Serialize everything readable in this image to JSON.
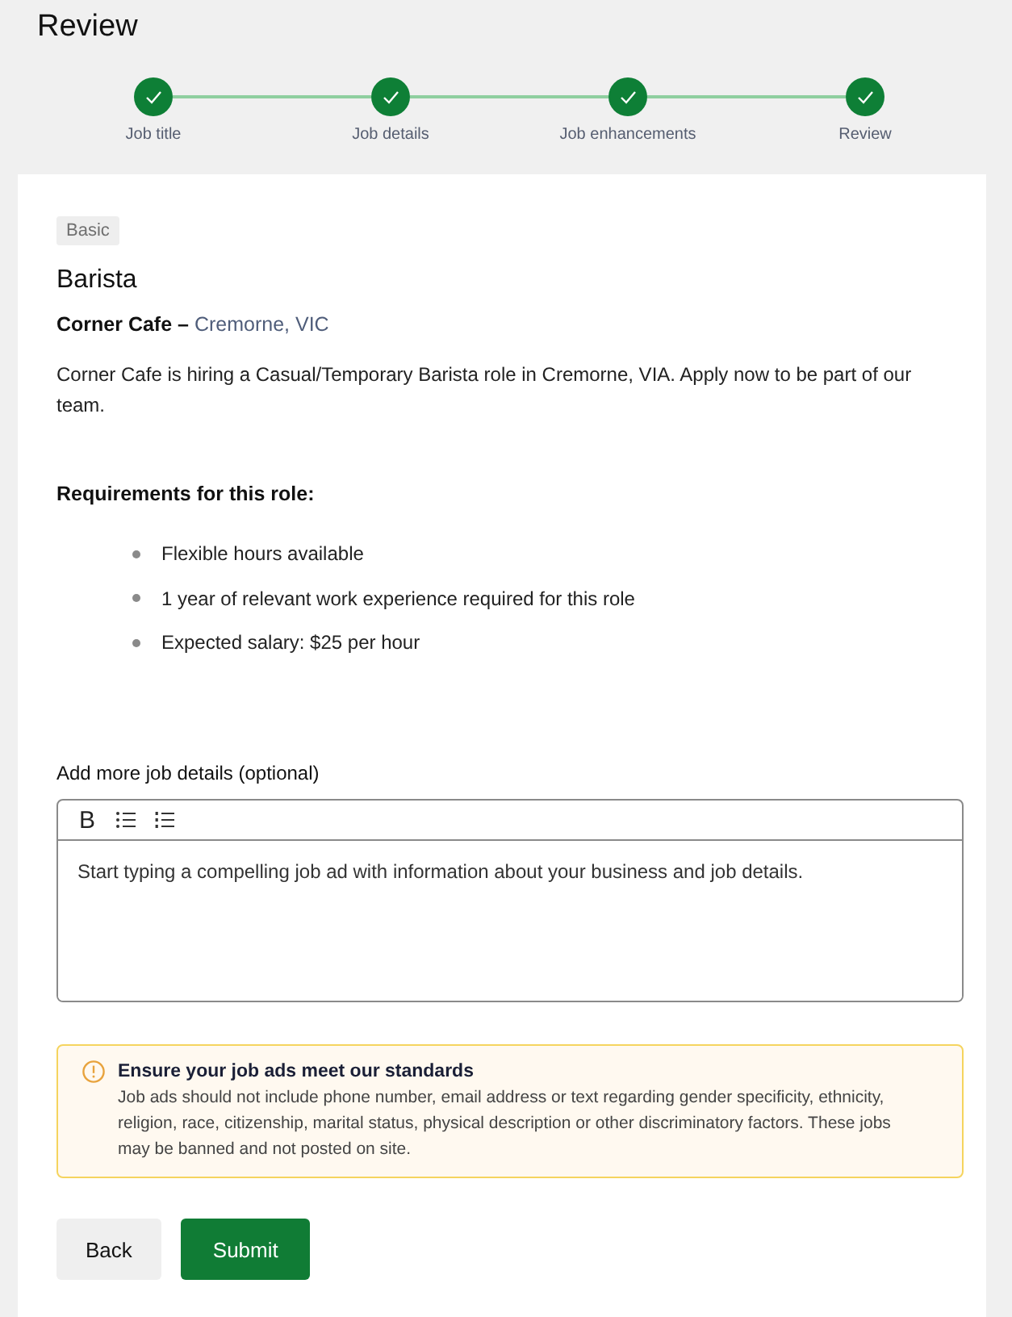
{
  "page": {
    "title": "Review"
  },
  "steps": [
    {
      "label": "Job title",
      "completed": true
    },
    {
      "label": "Job details",
      "completed": true
    },
    {
      "label": "Job enhancements",
      "completed": true
    },
    {
      "label": "Review",
      "completed": true
    }
  ],
  "job": {
    "tier_badge": "Basic",
    "title": "Barista",
    "company_line": "**Corner Cafe –** Cremorne, VIC",
    "description": "Corner Cafe is hiring a Casual/Temporary Barista role in Cremorne, VIA. Apply now to be part of our team."
  },
  "requirements": {
    "heading": "Requirements for this role:",
    "items": [
      "Flexible hours available",
      "1 year of relevant work experience required for this role",
      "Expected salary: $25 per hour"
    ]
  },
  "details_editor": {
    "label": "Add more job details (optional)",
    "toolbar": [
      {
        "kind": "bold",
        "label": "B"
      },
      {
        "kind": "bullet_list"
      },
      {
        "kind": "numbered_list"
      }
    ],
    "placeholder": "Start typing a compelling job ad with information about your business and job details."
  },
  "notice": {
    "title": "Ensure your job ads meet our standards",
    "body": "Job ads should not include phone number, email address or text regarding gender specificity, ethnicity, religion, race, citizenship, marital status, physical description or other discriminatory factors. These jobs may be banned and not posted on site."
  },
  "buttons": [
    {
      "label": "Back",
      "kind": "secondary"
    },
    {
      "label": "Submit",
      "kind": "primary"
    }
  ]
}
